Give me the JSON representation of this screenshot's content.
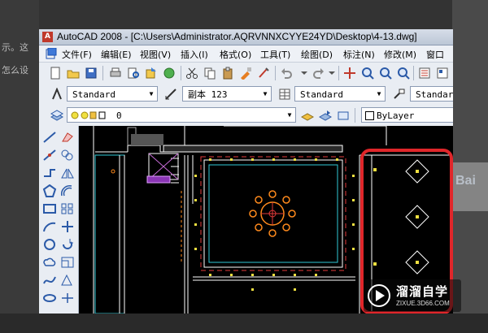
{
  "window": {
    "title": "AutoCAD 2008 - [C:\\Users\\Administrator.AQRVNNXCYYE24YD\\Desktop\\4-13.dwg]",
    "logo": "A"
  },
  "menu": [
    "文件(F)",
    "编辑(E)",
    "视图(V)",
    "插入(I)",
    "格式(O)",
    "工具(T)",
    "绘图(D)",
    "标注(N)",
    "修改(M)",
    "窗口"
  ],
  "toolbar2": {
    "text_style": "Standard",
    "dim_style": "副本 123",
    "table_style": "Standard",
    "multileader_style": "Standar"
  },
  "toolbar3": {
    "layer": "0",
    "color": "ByLayer"
  },
  "backdrop": {
    "bleed_left_1": "示。这",
    "bleed_left_2": "怎么设",
    "bleed_right": "Bai"
  },
  "watermark": {
    "brand": "溜溜自学",
    "url": "ZIXUE.3D66.COM"
  },
  "icons": {
    "app": "autocad-logo-icon",
    "play": "play-logo-icon"
  },
  "colors": {
    "highlight": "#e0262a",
    "wall": "#ffffff",
    "cyan": "#2fc7d6",
    "yellow": "#f0e040",
    "orange": "#ff8a1c",
    "red_dash": "#e23a3a"
  }
}
